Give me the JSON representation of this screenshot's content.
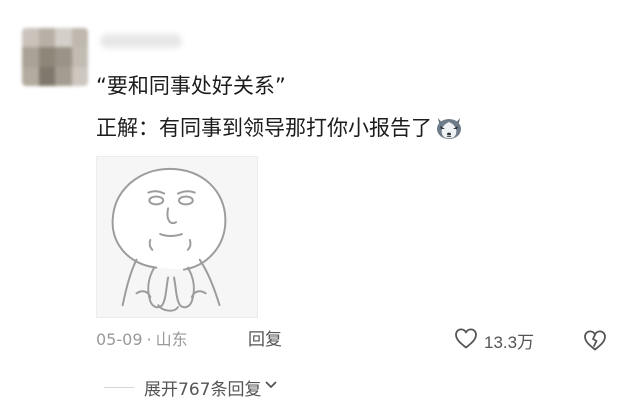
{
  "comment": {
    "quote": "“要和同事处好关系”",
    "body": "正解：有同事到领导那打你小报告了",
    "inline_emoji": "husky-dog-emoji",
    "sticker": "meme-face-sticker"
  },
  "meta": {
    "date": "05-09",
    "separator": "·",
    "location": "山东",
    "reply_label": "回复"
  },
  "actions": {
    "like_count": "13.3万",
    "like_icon": "heart-outline-icon",
    "dislike_icon": "broken-heart-icon"
  },
  "replies": {
    "expand_label": "展开767条回复",
    "expand_icon": "chevron-down-icon"
  },
  "colors": {
    "text": "#1c1c1c",
    "meta": "#9a9a9a",
    "action": "#555555"
  }
}
